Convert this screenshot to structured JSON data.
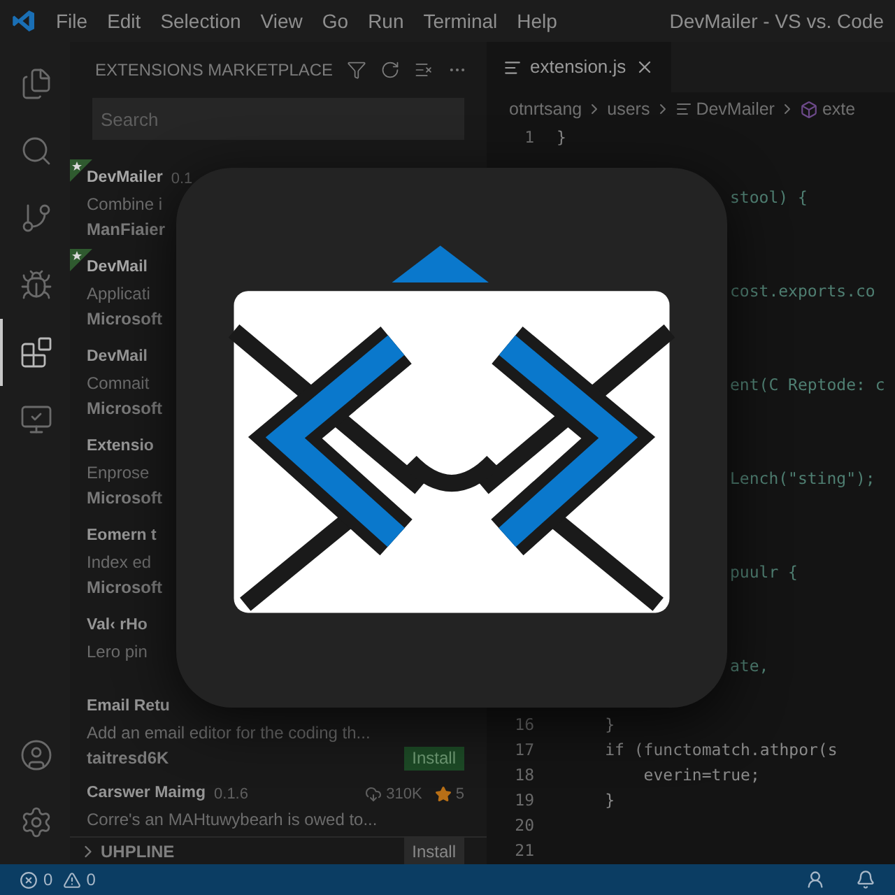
{
  "title_bar": {
    "menu": [
      "File",
      "Edit",
      "Selection",
      "View",
      "Go",
      "Run",
      "Terminal",
      "Help"
    ],
    "title": "DevMailer - VS vs. Code"
  },
  "activity_bar": {
    "items": [
      {
        "kind": "files",
        "selected": false
      },
      {
        "kind": "search",
        "selected": false
      },
      {
        "kind": "source-control",
        "selected": false
      },
      {
        "kind": "run-debug",
        "selected": false
      },
      {
        "kind": "extensions",
        "selected": true
      },
      {
        "kind": "remote",
        "selected": false
      }
    ],
    "bottom": [
      {
        "kind": "account"
      },
      {
        "kind": "settings"
      }
    ]
  },
  "sidebar": {
    "title": "EXTENSIONS MARKETPLACE",
    "search": {
      "placeholder": "Search"
    },
    "extensions": [
      {
        "name": "DevMailer",
        "version": "0.1",
        "description": "Combine i",
        "publisher": "ManFiaier",
        "featured": true
      },
      {
        "name": "DevMail",
        "description": "Applicati",
        "publisher": "Microsoft",
        "featured": true
      },
      {
        "name": "DevMail",
        "description": "Comnait",
        "publisher": "Microsoft",
        "featured": false
      },
      {
        "name": "Extensio",
        "description": "Enprose",
        "publisher": "Microsoft",
        "featured": false
      },
      {
        "name": "Eomern t",
        "description": "Index ed",
        "publisher": "Microsoft",
        "featured": false
      },
      {
        "name": "Val‹ rHo",
        "description": "Lero pin",
        "featured": false
      },
      {
        "name": "Email Retu",
        "description": "Add an email editor for the coding th...",
        "publisher": "taitresd6K",
        "featured": false,
        "install": "Install"
      },
      {
        "name": "Carswer Maimg",
        "version": "0.1.6",
        "downloads": "310K",
        "rating": "5",
        "description": "Corre's an MAHtuwybearh is owed to...",
        "featured": false
      }
    ],
    "section": {
      "title": "UHPLINE",
      "expanded": false,
      "button": "Install"
    }
  },
  "editor": {
    "tab": {
      "label": "extension.js",
      "selected": true
    },
    "breadcrumbs": [
      {
        "label": "otnrtsang",
        "kind": "folder"
      },
      {
        "label": "users",
        "kind": "folder"
      },
      {
        "label": "DevMailer",
        "kind": "file"
      },
      {
        "label": "exte",
        "kind": "symbol"
      }
    ],
    "lines": [
      {
        "kind": "full",
        "number": "1",
        "code": "}"
      },
      {
        "kind": "clipped",
        "code": "stool) {"
      },
      {
        "kind": "clipped",
        "code": "cost.exports.co"
      },
      {
        "kind": "clipped",
        "code": "ent(C Reptode: c"
      },
      {
        "kind": "clipped",
        "code": "Lench(\"sting\");"
      },
      {
        "kind": "clipped",
        "code": "puulr {"
      },
      {
        "kind": "clipped",
        "code": "ate,"
      },
      {
        "kind": "full",
        "number": "16",
        "code": "     }"
      },
      {
        "kind": "full",
        "number": "17",
        "code": "     if (functomatch.athpor(s"
      },
      {
        "kind": "full",
        "number": "18",
        "code": "         everin=true;"
      },
      {
        "kind": "full",
        "number": "19",
        "code": "     }"
      },
      {
        "kind": "full",
        "number": "20"
      },
      {
        "kind": "full",
        "number": "21"
      }
    ]
  },
  "status_bar": {
    "errors": "0",
    "warnings": "0"
  }
}
